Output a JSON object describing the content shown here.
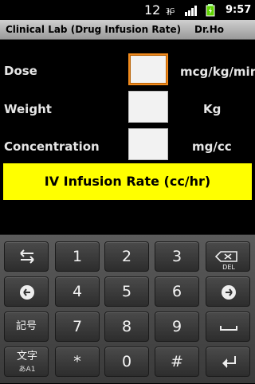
{
  "status_bar": {
    "notification": "12",
    "network": "3G",
    "time": "9:57"
  },
  "title_bar": {
    "title": "Clinical Lab (Drug Infusion Rate)",
    "author": "Dr.Ho"
  },
  "form": {
    "fields": [
      {
        "label": "Dose",
        "unit": "mcg/kg/min",
        "value": ""
      },
      {
        "label": "Weight",
        "unit": "Kg",
        "value": ""
      },
      {
        "label": "Concentration",
        "unit": "mg/cc",
        "value": ""
      }
    ],
    "calculate_label": "IV Infusion Rate (cc/hr)"
  },
  "keyboard": {
    "rows": [
      [
        "tab",
        "1",
        "2",
        "3",
        "DEL"
      ],
      [
        "left",
        "4",
        "5",
        "6",
        "right"
      ],
      [
        "記号",
        "7",
        "8",
        "9",
        "space"
      ],
      [
        "文字",
        "*",
        "0",
        "#",
        "enter"
      ]
    ],
    "mode_sub": "あA1"
  },
  "colors": {
    "accent": "#ffff00",
    "focus_border": "#f08a1d"
  }
}
